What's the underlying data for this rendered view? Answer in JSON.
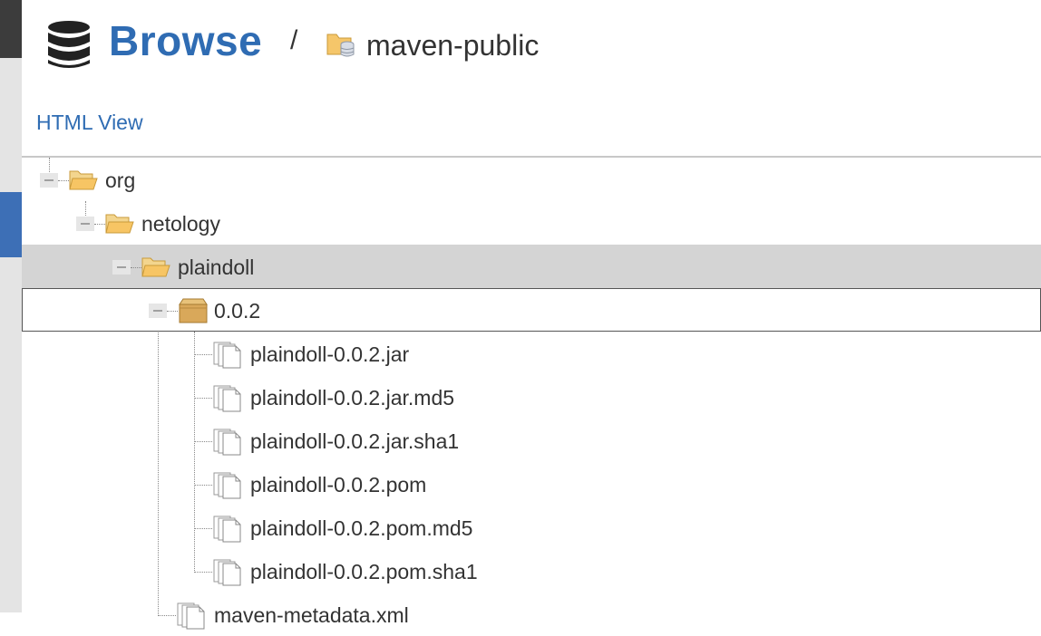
{
  "header": {
    "breadcrumb_root": "Browse",
    "separator": "/",
    "repository": "maven-public",
    "root_icon": "database-icon",
    "repo_icon": "folder-database-icon"
  },
  "html_view_link": "HTML View",
  "tree": {
    "org": {
      "label": "org",
      "icon": "folder-open-icon"
    },
    "netology": {
      "label": "netology",
      "icon": "folder-open-icon"
    },
    "plaindoll": {
      "label": "plaindoll",
      "icon": "folder-open-icon"
    },
    "version": {
      "label": "0.0.2",
      "icon": "package-icon"
    },
    "files": [
      {
        "label": "plaindoll-0.0.2.jar",
        "icon": "file-icon"
      },
      {
        "label": "plaindoll-0.0.2.jar.md5",
        "icon": "file-icon"
      },
      {
        "label": "plaindoll-0.0.2.jar.sha1",
        "icon": "file-icon"
      },
      {
        "label": "plaindoll-0.0.2.pom",
        "icon": "file-icon"
      },
      {
        "label": "plaindoll-0.0.2.pom.md5",
        "icon": "file-icon"
      },
      {
        "label": "plaindoll-0.0.2.pom.sha1",
        "icon": "file-icon"
      }
    ],
    "metadata": {
      "label": "maven-metadata.xml",
      "icon": "file-icon"
    }
  },
  "colors": {
    "accent": "#2f6cb3",
    "selected_row": "#d4d4d4",
    "folder": "#f5c66a"
  }
}
